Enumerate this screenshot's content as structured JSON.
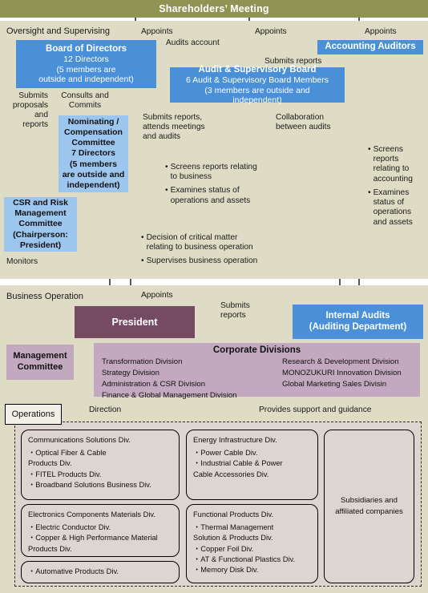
{
  "header": {
    "title": "Shareholders’ Meeting"
  },
  "sections": {
    "oversight_label": "Oversight and Supervising",
    "business_label": "Business\nOperation",
    "operations_label": "Operations"
  },
  "boxes": {
    "board_of_directors": {
      "title": "Board of Directors",
      "line1": "12 Directors",
      "line2": "(5 members are",
      "line3": "outside and independent)"
    },
    "audit_supervisory_board": {
      "title": "Audit & Supervisory Board",
      "line1": "6 Audit & Supervisory Board Members",
      "line2": "(3 members are outside and",
      "line3": "independent)"
    },
    "accounting_auditors": {
      "title": "Accounting Auditors"
    },
    "nominating_committee": {
      "text": "Nominating /\nCompensation\nCommittee\n7 Directors\n(5 members\nare outside and\nindependent)"
    },
    "csr_committee": {
      "text": "CSR and Risk\nManagement\nCommittee\n(Chairperson:\nPresident)"
    },
    "president": {
      "title": "President"
    },
    "management_committee": {
      "text": "Management\nCommittee"
    },
    "internal_audits": {
      "line1": "Internal Audits",
      "line2": "(Auditing Department)"
    },
    "corporate_divisions": {
      "title": "Corporate Divisions",
      "left_items": [
        "Transformation Division",
        "Strategy Division",
        "Administration & CSR Division",
        "Finance & Global Management Division"
      ],
      "right_items": [
        "Research & Development Division",
        "MONOZUKURI Innovation Division",
        "Global Marketing Sales Divisin"
      ]
    }
  },
  "edge_labels": {
    "appoints_board": "Appoints",
    "appoints_asb": "Appoints",
    "appoints_auditors": "Appoints",
    "audits_account": "Audits account",
    "submits_reports_auditors": "Submits reports",
    "submits_proposals": "Submits\nproposals\nand\nreports",
    "consults_commits": "Consults and\nCommits",
    "submits_reports_attends": "Submits reports,\nattends meetings\nand audits",
    "collaboration": "Collaboration\nbetween audits",
    "monitors": "Monitors",
    "appoints_president": "Appoints",
    "submits_reports_president": "Submits\nreports",
    "direction": "Direction",
    "provides_support": "Provides support and guidance"
  },
  "bullet_groups": {
    "asb_duties": [
      "Screens reports relating\nto business",
      "Examines status of\noperations and assets"
    ],
    "board_duties": [
      "Decision of critical matter\nrelating to business operation",
      "Supervises business operation"
    ],
    "auditor_duties": [
      "Screens\nreports\nrelating to\naccounting",
      "Examines\nstatus of\noperations\nand assets"
    ]
  },
  "operations": {
    "cards": [
      {
        "head": "Communications Solutions Div.",
        "items": "・Optical Fiber & Cable\n   Products Div.\n・FITEL Products Div.\n・Broadband Solutions Business Div."
      },
      {
        "head": "Electronics Components Materials Div.",
        "items": "・Electric Conductor Div.\n・Copper & High Performance Material\n   Products Div."
      },
      {
        "head": "",
        "items": "・Automative Products Div."
      },
      {
        "head": "Energy Infrastructure Div.",
        "items": "・Power Cable Div.\n・Industrial Cable & Power\n   Cable Accessories Div."
      },
      {
        "head": "Functional Products Div.",
        "items": "・Thermal Management\n   Solution & Products Div.\n・Copper Foil Div.\n・AT & Functional Plastics Div.\n・Memory Disk Div."
      }
    ],
    "subsidiaries": "Subsidiaries and\naffiliated companies"
  },
  "colors": {
    "header_green": "#8f9455",
    "panel_beige": "#dedcc4",
    "blue": "#4a90d9",
    "light_blue": "#9dc6ef",
    "president_purple": "#764a63",
    "mauve": "#c2a9bf",
    "ops_grey": "#ddd5cf"
  }
}
